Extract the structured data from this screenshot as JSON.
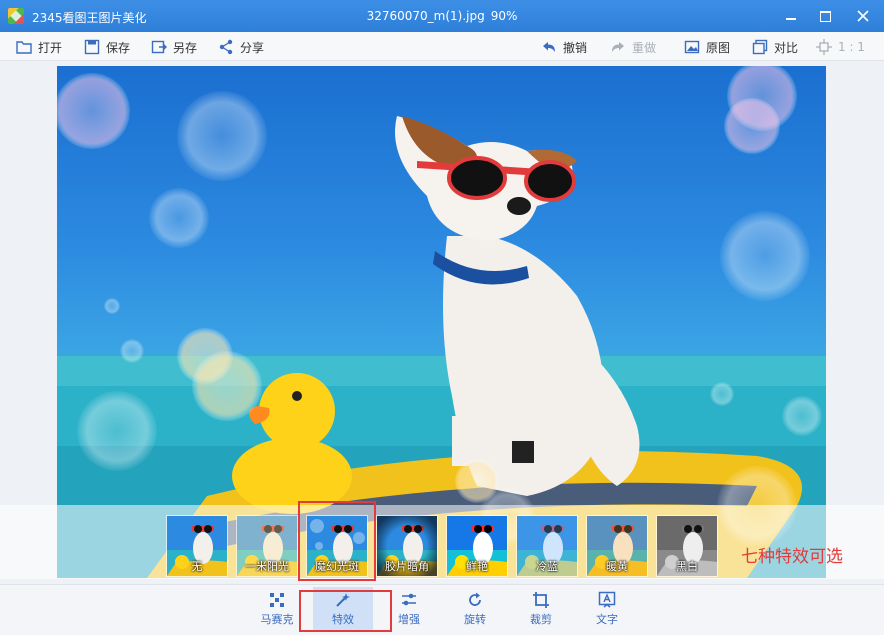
{
  "titlebar": {
    "app_name": "2345看图王图片美化",
    "file_name": "32760070_m(1).jpg",
    "zoom": "90%"
  },
  "toolbar": {
    "open": "打开",
    "save": "保存",
    "save_as": "另存",
    "share": "分享",
    "undo": "撤销",
    "redo": "重做",
    "original": "原图",
    "compare": "对比",
    "ratio": "1 : 1"
  },
  "filters": [
    {
      "label": "无",
      "tint": "none"
    },
    {
      "label": "一米阳光",
      "tint": "#ffe9a8"
    },
    {
      "label": "魔幻光斑",
      "tint": "#bfe3ff"
    },
    {
      "label": "胶片暗角",
      "tint": "#1a2a40"
    },
    {
      "label": "鲜艳",
      "tint": "#ff7ad0"
    },
    {
      "label": "冷蓝",
      "tint": "#6fb7ff"
    },
    {
      "label": "暖黄",
      "tint": "#ffb347"
    },
    {
      "label": "黑白",
      "tint": "grayscale"
    }
  ],
  "selected_filter": "魔幻光斑",
  "annotation": "七种特效可选",
  "bottom_tools": {
    "mosaic": "马赛克",
    "effects": "特效",
    "enhance": "增强",
    "rotate": "旋转",
    "crop": "裁剪",
    "text": "文字"
  },
  "colors": {
    "accent": "#2f7fd9",
    "highlight": "#e23b3b"
  }
}
